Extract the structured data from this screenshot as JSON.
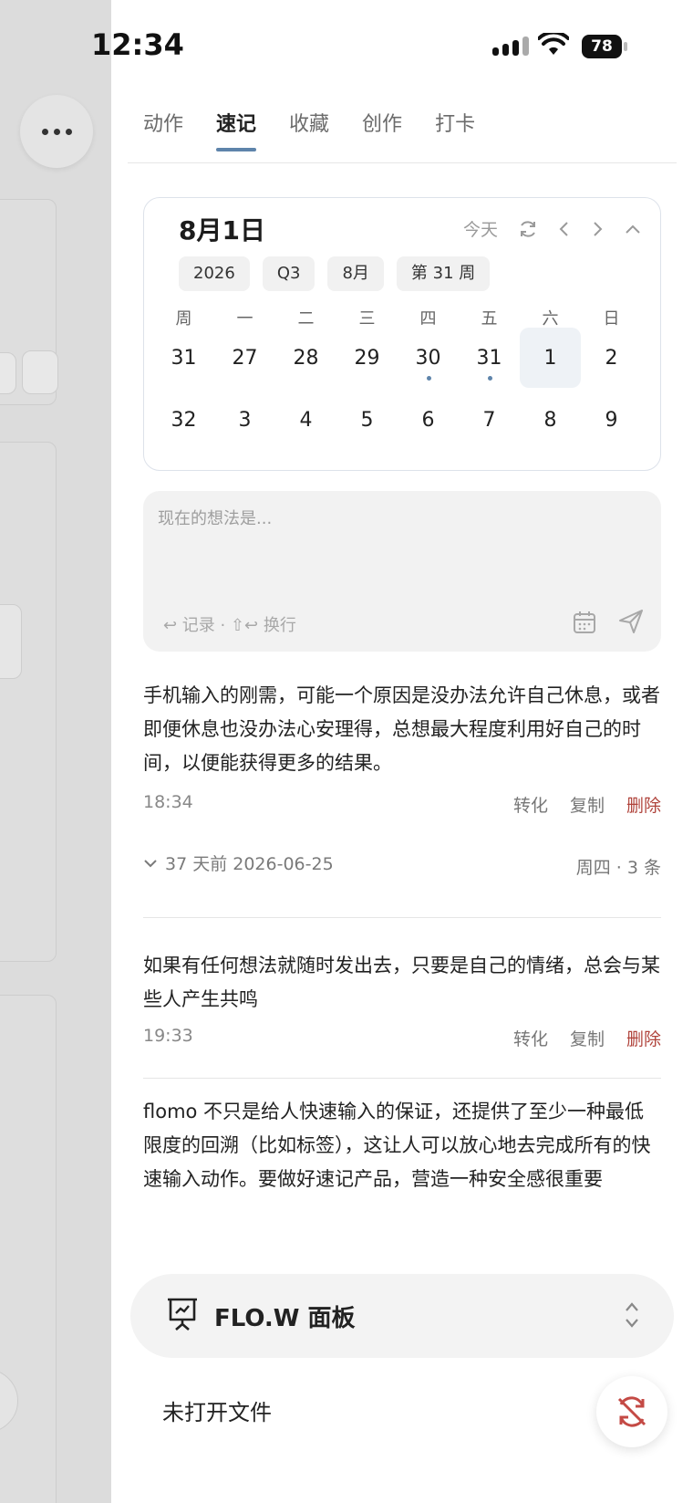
{
  "status_bar": {
    "time": "12:34",
    "battery": "78"
  },
  "tabs": [
    {
      "label": "动作",
      "active": false
    },
    {
      "label": "速记",
      "active": true
    },
    {
      "label": "收藏",
      "active": false
    },
    {
      "label": "创作",
      "active": false
    },
    {
      "label": "打卡",
      "active": false
    }
  ],
  "calendar": {
    "title": "8月1日",
    "today_label": "今天",
    "chips": [
      "2026",
      "Q3",
      "8月",
      "第 31 周"
    ],
    "week_header": [
      "周",
      "一",
      "二",
      "三",
      "四",
      "五",
      "六",
      "日"
    ],
    "rows": [
      [
        "31",
        "27",
        "28",
        "29",
        "30",
        "31",
        "1",
        "2"
      ],
      [
        "32",
        "3",
        "4",
        "5",
        "6",
        "7",
        "8",
        "9"
      ]
    ]
  },
  "composer": {
    "placeholder": "现在的想法是...",
    "hint": "↩ 记录 · ⇧↩ 换行"
  },
  "notes": [
    {
      "text": "手机输入的刚需，可能一个原因是没办法允许自己休息，或者即便休息也没办法心安理得，总想最大程度利用好自己的时间，以便能获得更多的结果。",
      "time": "18:34"
    },
    {
      "text": "如果有任何想法就随时发出去，只要是自己的情绪，总会与某些人产生共鸣",
      "time": "19:33"
    },
    {
      "text": "flomo 不只是给人快速输入的保证，还提供了至少一种最低限度的回溯（比如标签），这让人可以放心地去完成所有的快速输入动作。要做好速记产品，营造一种安全感很重要"
    }
  ],
  "note_actions": {
    "convert": "转化",
    "copy": "复制",
    "delete": "删除"
  },
  "group": {
    "label": "37 天前 2026-06-25",
    "summary": "周四 · 3 条"
  },
  "flow_panel": {
    "title": "FLO.W 面板"
  },
  "no_file": "未打开文件",
  "colors": {
    "accent": "#5e84ab",
    "danger": "#b0433b"
  }
}
